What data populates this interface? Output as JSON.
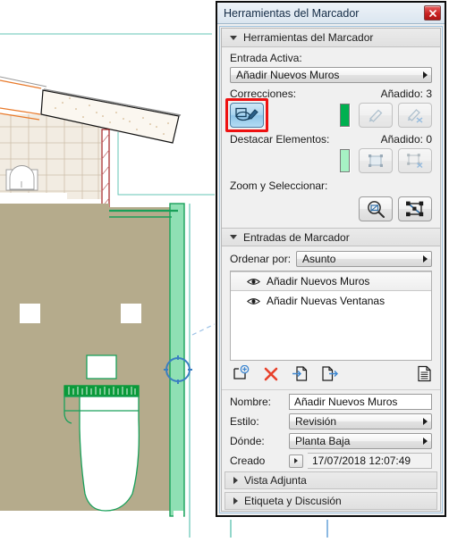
{
  "window": {
    "title": "Herramientas del Marcador",
    "close_icon": "close-icon",
    "close_glyph": "✖"
  },
  "tools_section": {
    "header": "Herramientas del Marcador",
    "active_entry_label": "Entrada Activa:",
    "active_entry_value": "Añadir Nuevos Muros",
    "corrections": {
      "label": "Correcciones:",
      "count_label": "Añadido: 3",
      "swatch_color": "#00b050",
      "buttons": [
        {
          "name": "draw-correction-button",
          "state": "active-highlighted"
        },
        {
          "name": "edit-correction-button",
          "state": "disabled"
        },
        {
          "name": "remove-correction-button",
          "state": "disabled"
        }
      ]
    },
    "highlight": {
      "label": "Destacar Elementos:",
      "count_label": "Añadido: 0",
      "swatch_color": "#a6f2c4",
      "buttons": [
        {
          "name": "add-highlight-button",
          "state": "disabled"
        },
        {
          "name": "remove-highlight-button",
          "state": "disabled"
        }
      ]
    },
    "zoom_select": {
      "label": "Zoom y Seleccionar:",
      "buttons": [
        {
          "name": "zoom-to-markup-button",
          "state": "normal"
        },
        {
          "name": "select-elements-button",
          "state": "normal"
        }
      ]
    }
  },
  "entries_section": {
    "header": "Entradas de Marcador",
    "sort_label": "Ordenar por:",
    "sort_value": "Asunto",
    "items": [
      {
        "label": "Añadir Nuevos Muros",
        "selected": true
      },
      {
        "label": "Añadir Nuevas Ventanas",
        "selected": false
      }
    ],
    "actions": [
      {
        "name": "new-entry-button",
        "title": "Nueva Entrada"
      },
      {
        "name": "delete-entry-button",
        "title": "Borrar"
      },
      {
        "name": "import-entry-button",
        "title": "Importar"
      },
      {
        "name": "export-entry-button",
        "title": "Exportar"
      },
      {
        "name": "entry-details-button",
        "title": "Detalles"
      }
    ],
    "fields": {
      "name_label": "Nombre:",
      "name_value": "Añadir Nuevos Muros",
      "style_label": "Estilo:",
      "style_value": "Revisión",
      "where_label": "Dónde:",
      "where_value": "Planta Baja",
      "created_label": "Creado",
      "created_value": "17/07/2018 12:07:49"
    }
  },
  "collapsed_sections": [
    {
      "label": "Vista Adjunta"
    },
    {
      "label": "Etiqueta y Discusión"
    }
  ],
  "drawing": {
    "name": "floor-plan-canvas",
    "colors": {
      "room_fill": "#b5ab8c",
      "markup_green": "#19a05a",
      "markup_green_fill": "#8fe0b4",
      "wall_red": "#a02020",
      "orange_line": "#e8792a",
      "teal_guide": "#63c4b4",
      "blue_guide": "#5b9bd5"
    }
  }
}
